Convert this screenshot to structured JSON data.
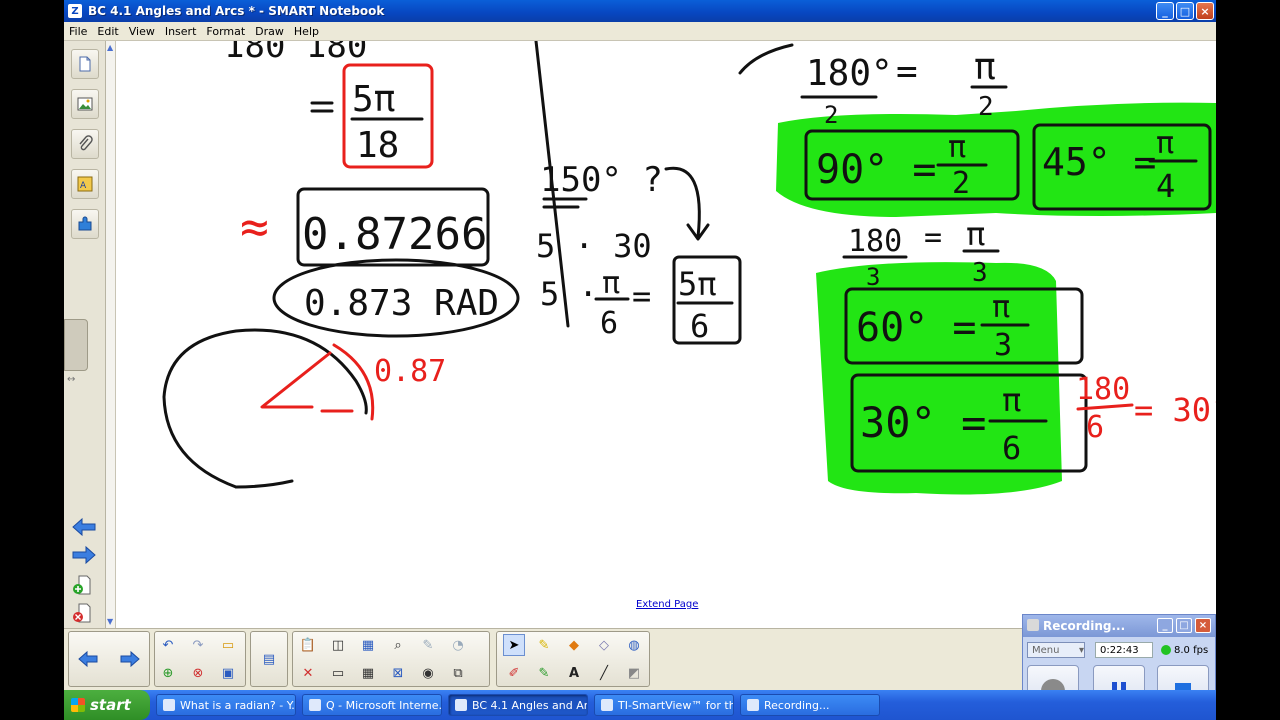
{
  "window": {
    "title": "BC 4.1 Angles and Arcs * - SMART Notebook",
    "app_icon_glyph": "Z",
    "controls": {
      "minimize": "_",
      "maximize": "□",
      "close": "×"
    }
  },
  "menu": [
    "File",
    "Edit",
    "View",
    "Insert",
    "Format",
    "Draw",
    "Help"
  ],
  "sidebar": {
    "tabs": [
      "page-sorter-icon",
      "gallery-icon",
      "attachments-icon",
      "properties-icon",
      "addons-icon"
    ],
    "nav": [
      "previous-page-icon",
      "next-page-icon",
      "add-page-icon",
      "delete-page-icon"
    ]
  },
  "canvas": {
    "extend_page": "Extend Page",
    "ink": {
      "top_partial": "180   180",
      "frac1_num": "5π",
      "frac1_den": "18",
      "approx": "≈",
      "decimal": "0.87266",
      "rad": "0.873 RAD",
      "arc_label": "0.87",
      "q150": "150° ?",
      "s30": "5 · 30",
      "s_pi_num": "π",
      "s_pi_den": "6",
      "s_prefix": "5 ·",
      "s_eq": "=",
      "ans_num": "5π",
      "ans_den": "6",
      "half_num": "180°",
      "half_den": "2",
      "half_eq": "=",
      "half_pi": "π",
      "half_pi_den": "2",
      "e90": "90° =",
      "e90_num": "π",
      "e90_den": "2",
      "e45": "45° =",
      "e45_num": "π",
      "e45_den": "4",
      "third_num": "180",
      "third_den": "3",
      "third_eq": "=",
      "third_pi": "π",
      "third_pi_den": "3",
      "e60": "60° =",
      "e60_num": "π",
      "e60_den": "3",
      "e30": "30° =",
      "e30_num": "π",
      "e30_den": "6",
      "sixth_num": "180",
      "sixth_den": "6",
      "sixth_res": "= 30°"
    }
  },
  "recorder": {
    "title": "Recording...",
    "menu": "Menu",
    "time": "0:22:43",
    "fps": "8.0 fps"
  },
  "taskbar": {
    "start": "start",
    "items": [
      "What is a radian? - Y...",
      "Q - Microsoft Interne...",
      "BC 4.1 Angles and Ar...",
      "TI-SmartView™ for th...",
      "Recording..."
    ]
  },
  "colors": {
    "highlight_green": "#22e514",
    "ink_red": "#e8201c",
    "ink_black": "#111111",
    "title_blue": "#0846c0"
  }
}
